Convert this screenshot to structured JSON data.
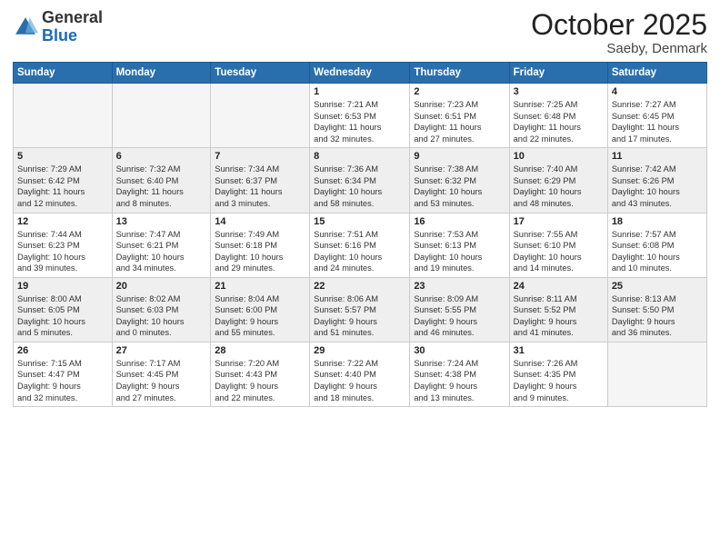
{
  "logo": {
    "general": "General",
    "blue": "Blue"
  },
  "header": {
    "month": "October 2025",
    "location": "Saeby, Denmark"
  },
  "weekdays": [
    "Sunday",
    "Monday",
    "Tuesday",
    "Wednesday",
    "Thursday",
    "Friday",
    "Saturday"
  ],
  "rows": [
    {
      "cells": [
        {
          "day": "",
          "content": ""
        },
        {
          "day": "",
          "content": ""
        },
        {
          "day": "",
          "content": ""
        },
        {
          "day": "1",
          "content": "Sunrise: 7:21 AM\nSunset: 6:53 PM\nDaylight: 11 hours\nand 32 minutes."
        },
        {
          "day": "2",
          "content": "Sunrise: 7:23 AM\nSunset: 6:51 PM\nDaylight: 11 hours\nand 27 minutes."
        },
        {
          "day": "3",
          "content": "Sunrise: 7:25 AM\nSunset: 6:48 PM\nDaylight: 11 hours\nand 22 minutes."
        },
        {
          "day": "4",
          "content": "Sunrise: 7:27 AM\nSunset: 6:45 PM\nDaylight: 11 hours\nand 17 minutes."
        }
      ]
    },
    {
      "cells": [
        {
          "day": "5",
          "content": "Sunrise: 7:29 AM\nSunset: 6:42 PM\nDaylight: 11 hours\nand 12 minutes."
        },
        {
          "day": "6",
          "content": "Sunrise: 7:32 AM\nSunset: 6:40 PM\nDaylight: 11 hours\nand 8 minutes."
        },
        {
          "day": "7",
          "content": "Sunrise: 7:34 AM\nSunset: 6:37 PM\nDaylight: 11 hours\nand 3 minutes."
        },
        {
          "day": "8",
          "content": "Sunrise: 7:36 AM\nSunset: 6:34 PM\nDaylight: 10 hours\nand 58 minutes."
        },
        {
          "day": "9",
          "content": "Sunrise: 7:38 AM\nSunset: 6:32 PM\nDaylight: 10 hours\nand 53 minutes."
        },
        {
          "day": "10",
          "content": "Sunrise: 7:40 AM\nSunset: 6:29 PM\nDaylight: 10 hours\nand 48 minutes."
        },
        {
          "day": "11",
          "content": "Sunrise: 7:42 AM\nSunset: 6:26 PM\nDaylight: 10 hours\nand 43 minutes."
        }
      ]
    },
    {
      "cells": [
        {
          "day": "12",
          "content": "Sunrise: 7:44 AM\nSunset: 6:23 PM\nDaylight: 10 hours\nand 39 minutes."
        },
        {
          "day": "13",
          "content": "Sunrise: 7:47 AM\nSunset: 6:21 PM\nDaylight: 10 hours\nand 34 minutes."
        },
        {
          "day": "14",
          "content": "Sunrise: 7:49 AM\nSunset: 6:18 PM\nDaylight: 10 hours\nand 29 minutes."
        },
        {
          "day": "15",
          "content": "Sunrise: 7:51 AM\nSunset: 6:16 PM\nDaylight: 10 hours\nand 24 minutes."
        },
        {
          "day": "16",
          "content": "Sunrise: 7:53 AM\nSunset: 6:13 PM\nDaylight: 10 hours\nand 19 minutes."
        },
        {
          "day": "17",
          "content": "Sunrise: 7:55 AM\nSunset: 6:10 PM\nDaylight: 10 hours\nand 14 minutes."
        },
        {
          "day": "18",
          "content": "Sunrise: 7:57 AM\nSunset: 6:08 PM\nDaylight: 10 hours\nand 10 minutes."
        }
      ]
    },
    {
      "cells": [
        {
          "day": "19",
          "content": "Sunrise: 8:00 AM\nSunset: 6:05 PM\nDaylight: 10 hours\nand 5 minutes."
        },
        {
          "day": "20",
          "content": "Sunrise: 8:02 AM\nSunset: 6:03 PM\nDaylight: 10 hours\nand 0 minutes."
        },
        {
          "day": "21",
          "content": "Sunrise: 8:04 AM\nSunset: 6:00 PM\nDaylight: 9 hours\nand 55 minutes."
        },
        {
          "day": "22",
          "content": "Sunrise: 8:06 AM\nSunset: 5:57 PM\nDaylight: 9 hours\nand 51 minutes."
        },
        {
          "day": "23",
          "content": "Sunrise: 8:09 AM\nSunset: 5:55 PM\nDaylight: 9 hours\nand 46 minutes."
        },
        {
          "day": "24",
          "content": "Sunrise: 8:11 AM\nSunset: 5:52 PM\nDaylight: 9 hours\nand 41 minutes."
        },
        {
          "day": "25",
          "content": "Sunrise: 8:13 AM\nSunset: 5:50 PM\nDaylight: 9 hours\nand 36 minutes."
        }
      ]
    },
    {
      "cells": [
        {
          "day": "26",
          "content": "Sunrise: 7:15 AM\nSunset: 4:47 PM\nDaylight: 9 hours\nand 32 minutes."
        },
        {
          "day": "27",
          "content": "Sunrise: 7:17 AM\nSunset: 4:45 PM\nDaylight: 9 hours\nand 27 minutes."
        },
        {
          "day": "28",
          "content": "Sunrise: 7:20 AM\nSunset: 4:43 PM\nDaylight: 9 hours\nand 22 minutes."
        },
        {
          "day": "29",
          "content": "Sunrise: 7:22 AM\nSunset: 4:40 PM\nDaylight: 9 hours\nand 18 minutes."
        },
        {
          "day": "30",
          "content": "Sunrise: 7:24 AM\nSunset: 4:38 PM\nDaylight: 9 hours\nand 13 minutes."
        },
        {
          "day": "31",
          "content": "Sunrise: 7:26 AM\nSunset: 4:35 PM\nDaylight: 9 hours\nand 9 minutes."
        },
        {
          "day": "",
          "content": ""
        }
      ]
    }
  ]
}
